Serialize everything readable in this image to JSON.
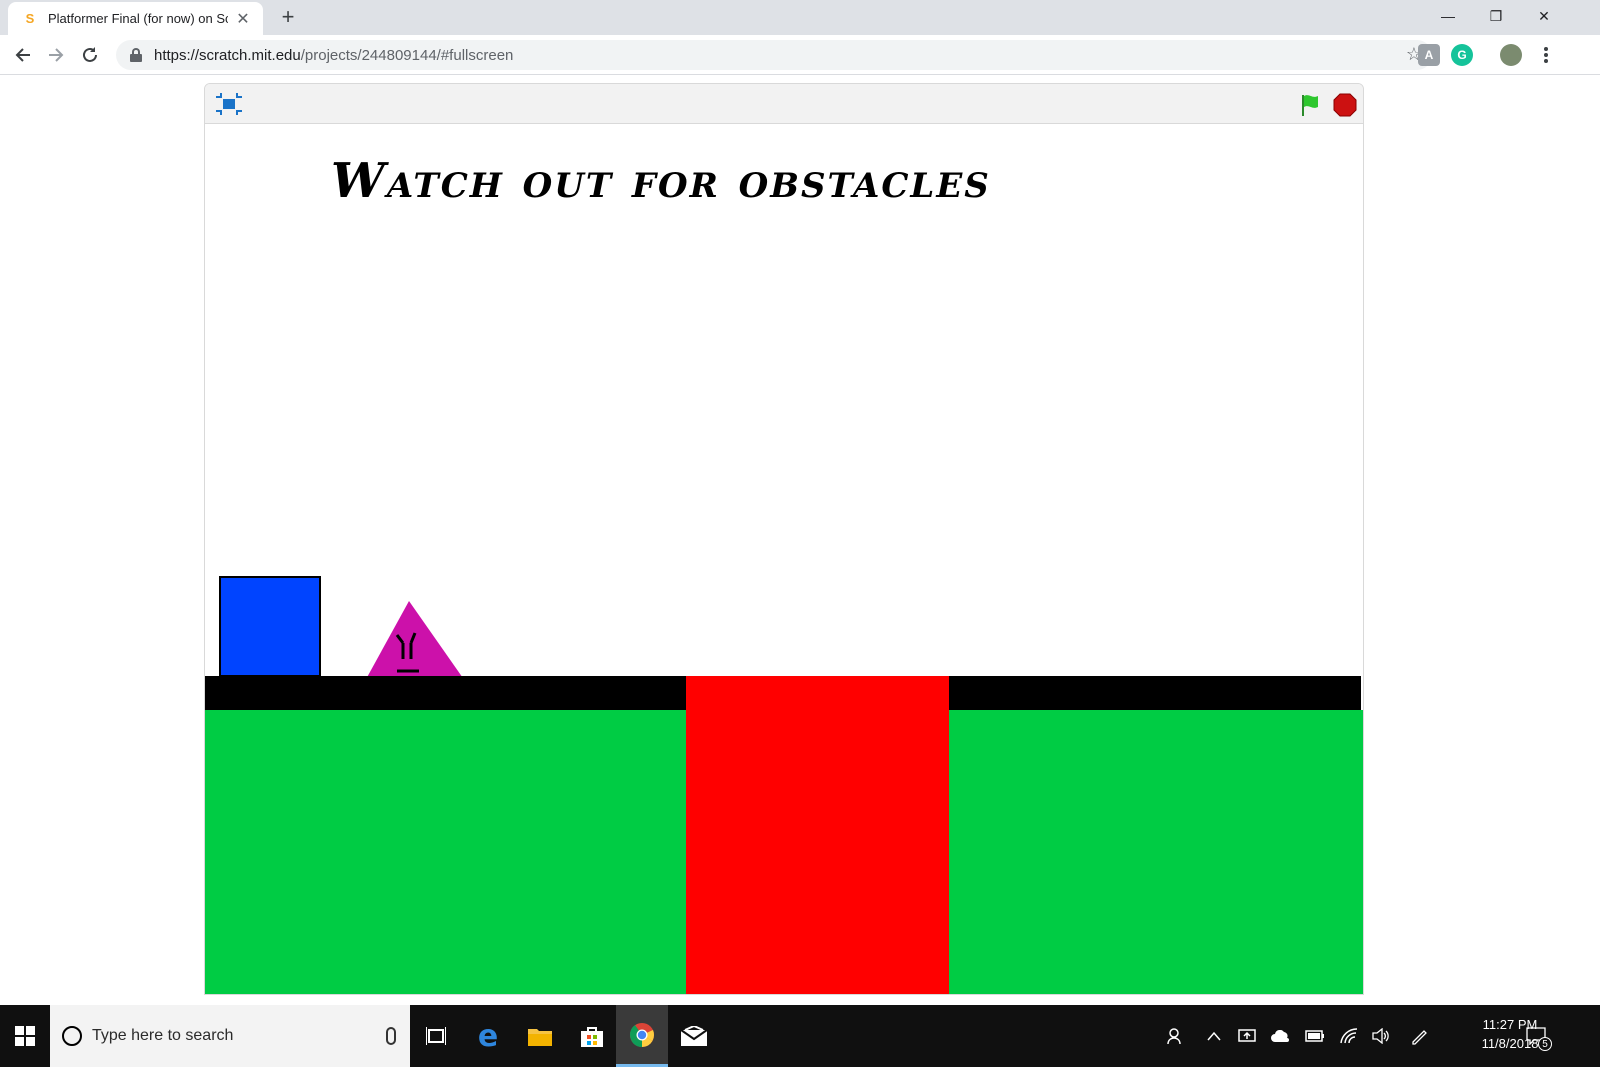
{
  "browser": {
    "tab_title": "Platformer Final (for now) on Scratch",
    "new_tab_glyph": "+",
    "close_glyph": "✕",
    "url_host": "https://scratch.mit.edu",
    "url_path": "/projects/244809144/#fullscreen",
    "window_controls": {
      "minimize": "—",
      "restore": "❐",
      "close": "✕"
    },
    "extensions": [
      {
        "name": "reader-extension-icon",
        "glyph": "A",
        "color": "#9aa0a6"
      },
      {
        "name": "grammarly-extension-icon",
        "glyph": "G",
        "color": "#15c39a"
      },
      {
        "name": "profile-avatar-icon",
        "glyph": "",
        "color": "#7b8b6f"
      }
    ]
  },
  "player": {
    "stage_title": "Watch out for obstacles",
    "colors": {
      "ground": "#000000",
      "grass": "#00cc44",
      "lava": "#ff0000",
      "player_block": "#0044ff",
      "enemy": "#cc11aa",
      "flag": "#2ec72e",
      "stop": "#cc1111"
    }
  },
  "taskbar": {
    "search_placeholder": "Type here to search",
    "clock_time": "11:27 PM",
    "clock_date": "11/8/2018",
    "notification_count": "5"
  }
}
